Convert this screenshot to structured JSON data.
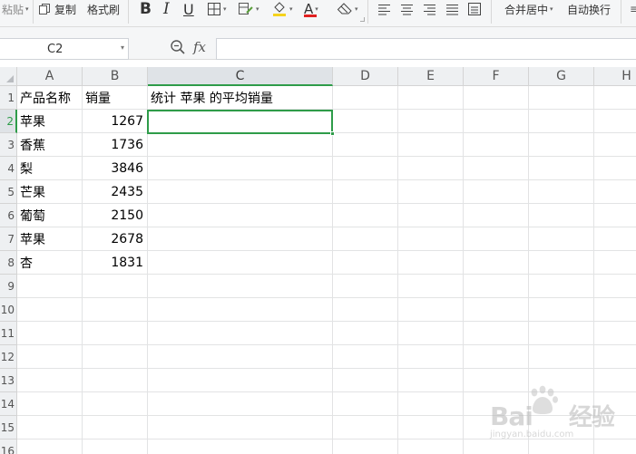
{
  "toolbar": {
    "paste_label": "粘贴",
    "copy_label": "复制",
    "format_painter_label": "格式刷",
    "bold_label": "B",
    "italic_label": "I",
    "underline_label": "U",
    "font_color_label": "A",
    "merge_center_label": "合并居中",
    "wrap_text_label": "自动换行",
    "accent_color": "#e02020",
    "fill_color": "#f5d21c"
  },
  "formula_bar": {
    "name_box": "C2",
    "fx_label": "fx",
    "formula": ""
  },
  "columns": [
    "A",
    "B",
    "C",
    "D",
    "E",
    "F",
    "G",
    "H"
  ],
  "active_column": "C",
  "active_row": "2",
  "rows": [
    "1",
    "2",
    "3",
    "4",
    "5",
    "6",
    "7",
    "8",
    "9",
    "10",
    "11",
    "12",
    "13",
    "14",
    "15",
    "16"
  ],
  "header_row": {
    "a": "产品名称",
    "b": "销量",
    "c": "统计  苹果  的平均销量"
  },
  "data_rows": [
    {
      "name": "苹果",
      "sales": "1267"
    },
    {
      "name": "香蕉",
      "sales": "1736"
    },
    {
      "name": "梨",
      "sales": "3846"
    },
    {
      "name": "芒果",
      "sales": "2435"
    },
    {
      "name": "葡萄",
      "sales": "2150"
    },
    {
      "name": "苹果",
      "sales": "2678"
    },
    {
      "name": "杏",
      "sales": "1831"
    }
  ],
  "watermark": {
    "brand": "Bai",
    "brand_cn": "经验",
    "url": "jingyan.baidu.com"
  },
  "colors": {
    "selection": "#2e9c49",
    "header_bg": "#eef0f2",
    "gridline": "#e2e3e4"
  }
}
